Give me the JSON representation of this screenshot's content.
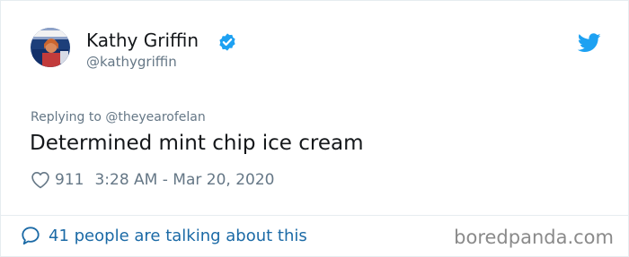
{
  "author": {
    "name": "Kathy Griffin",
    "handle": "@kathygriffin"
  },
  "reply_line": "Replying to @theyearofelan",
  "tweet_text": "Determined mint chip ice cream",
  "likes": "911",
  "timestamp": "3:28 AM - Mar 20, 2020",
  "footer": {
    "talking_label": "41 people are talking about this",
    "watermark": "boredpanda.com"
  },
  "icons": {
    "verified": "verified-badge-icon",
    "brand": "twitter-bird-icon",
    "like": "heart-outline-icon",
    "comment": "speech-bubble-icon"
  },
  "colors": {
    "name_text": "#14171a",
    "secondary_text": "#657786",
    "verified_blue": "#1da1f2",
    "link_blue": "#1b6aa6",
    "watermark": "#8a8a8a"
  }
}
